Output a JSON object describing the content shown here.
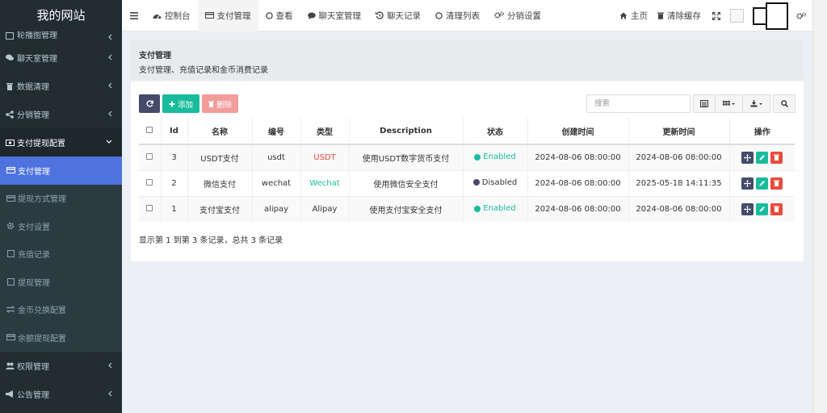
{
  "app": {
    "title": "我的网站"
  },
  "sidebar": {
    "items": [
      {
        "label": "轮播图管理",
        "state": "clipped"
      },
      {
        "label": "聊天室管理",
        "icon": "comments-icon"
      },
      {
        "label": "数据清理",
        "icon": "trash-icon"
      },
      {
        "label": "分销管理",
        "icon": "share-icon"
      },
      {
        "label": "支付提现配置",
        "icon": "money-icon",
        "open": true
      }
    ],
    "subitems": [
      {
        "label": "支付管理",
        "icon": "credit-card-icon",
        "active": true
      },
      {
        "label": "提现方式管理",
        "icon": "credit-card-icon"
      },
      {
        "label": "支付设置",
        "icon": "gear-icon"
      },
      {
        "label": "充值记录",
        "icon": "file-icon"
      },
      {
        "label": "提现管理",
        "icon": "file-icon"
      },
      {
        "label": "金币兑换配置",
        "icon": "exchange-icon"
      },
      {
        "label": "余额提现配置",
        "icon": "credit-card-icon"
      }
    ],
    "bottom": [
      {
        "label": "权限管理",
        "icon": "users-icon"
      },
      {
        "label": "公告管理",
        "icon": "bullhorn-icon"
      }
    ]
  },
  "topbar": {
    "tabs": [
      {
        "label": "控制台",
        "icon": "dashboard-icon"
      },
      {
        "label": "支付管理",
        "icon": "credit-card-icon",
        "active": true
      },
      {
        "label": "查看",
        "icon": "circle-icon"
      },
      {
        "label": "聊天室管理",
        "icon": "comments-icon"
      },
      {
        "label": "聊天记录",
        "icon": "history-icon"
      },
      {
        "label": "清理列表",
        "icon": "circle-icon"
      },
      {
        "label": "分销设置",
        "icon": "gears-icon"
      }
    ],
    "home": "主页",
    "clear_cache": "清除缓存"
  },
  "header": {
    "title": "支付管理",
    "subtitle": "支付管理、充值记录和金币消费记录"
  },
  "toolbar": {
    "add_label": "添加",
    "delete_label": "删除",
    "search_placeholder": "搜索"
  },
  "table": {
    "columns": [
      "Id",
      "名称",
      "编号",
      "类型",
      "Description",
      "状态",
      "创建时间",
      "更新时间",
      "操作"
    ],
    "rows": [
      {
        "id": "3",
        "name": "USDT支付",
        "code": "usdt",
        "type": "USDT",
        "type_color": "#e74c3c",
        "desc": "使用USDT数字货币支付",
        "status": "Enabled",
        "status_color": "#18bc9c",
        "created": "2024-08-06 08:00:00",
        "updated": "2024-08-06 08:00:00"
      },
      {
        "id": "2",
        "name": "微信支付",
        "code": "wechat",
        "type": "Wechat",
        "type_color": "#18bc9c",
        "desc": "使用微信安全支付",
        "status": "Disabled",
        "status_color": "#444c69",
        "created": "2024-08-06 08:00:00",
        "updated": "2025-05-18 14:11:35"
      },
      {
        "id": "1",
        "name": "支付宝支付",
        "code": "alipay",
        "type": "Alipay",
        "type_color": "#333333",
        "desc": "使用支付宝安全支付",
        "status": "Enabled",
        "status_color": "#18bc9c",
        "created": "2024-08-06 08:00:00",
        "updated": "2024-08-06 08:00:00"
      }
    ]
  },
  "pagination": {
    "summary": "显示第 1 到第 3 条记录，总共 3 条记录"
  },
  "colors": {
    "sidebar_bg": "#222d32",
    "active_blue": "#4e73df",
    "success": "#18bc9c",
    "danger": "#e74c3c",
    "primary_dark": "#444c69"
  }
}
